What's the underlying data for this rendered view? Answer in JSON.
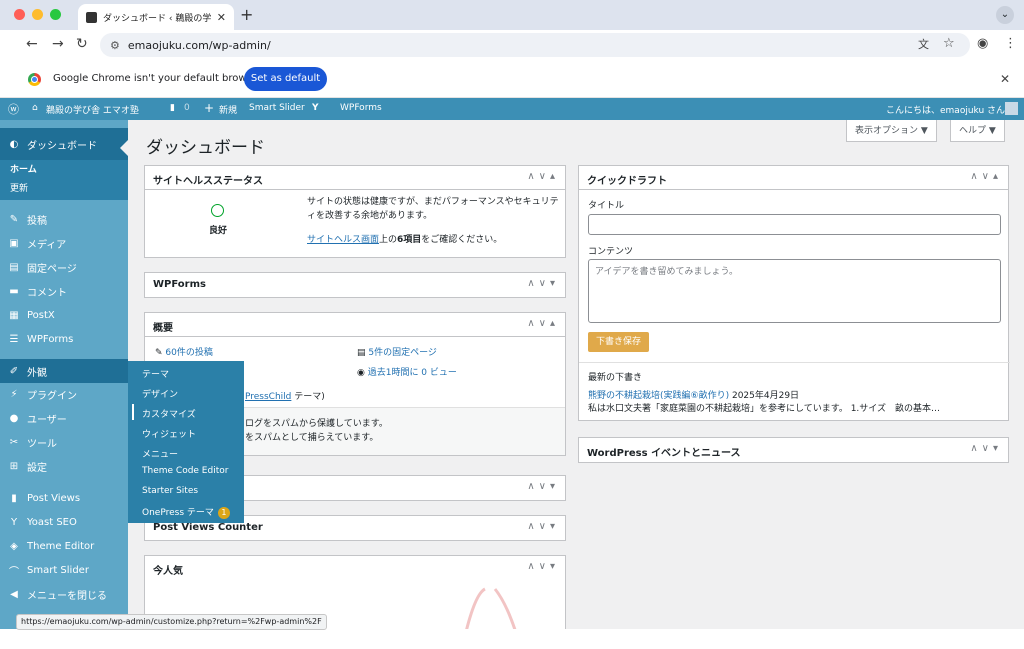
{
  "browser": {
    "tab_title": "ダッシュボード ‹ 鵜殿の学び舎 エ",
    "new_tab": "+",
    "url": "emaojuku.com/wp-admin/",
    "infobar_text": "Google Chrome isn't your default browser",
    "set_default": "Set as default",
    "status_url": "https://emaojuku.com/wp-admin/customize.php?return=%2Fwp-admin%2F"
  },
  "adminbar": {
    "site_name": "鵜殿の学び舎 エマオ塾",
    "comments": "0",
    "new": "新規",
    "smart_slider": "Smart Slider",
    "wpforms": "WPForms",
    "greeting": "こんにちは、emaojuku さん"
  },
  "sidebar": {
    "dashboard": "ダッシュボード",
    "home": "ホーム",
    "updates": "更新",
    "items": [
      {
        "label": "投稿",
        "icon": "pin-icon"
      },
      {
        "label": "メディア",
        "icon": "media-icon"
      },
      {
        "label": "固定ページ",
        "icon": "page-icon"
      },
      {
        "label": "コメント",
        "icon": "comment-icon"
      },
      {
        "label": "PostX",
        "icon": "postx-icon"
      },
      {
        "label": "WPForms",
        "icon": "wpforms-icon"
      },
      {
        "label": "外観",
        "icon": "appearance-icon"
      },
      {
        "label": "プラグイン",
        "icon": "plugin-icon"
      },
      {
        "label": "ユーザー",
        "icon": "user-icon"
      },
      {
        "label": "ツール",
        "icon": "tool-icon"
      },
      {
        "label": "設定",
        "icon": "settings-icon"
      },
      {
        "label": "Post Views",
        "icon": "chart-icon"
      },
      {
        "label": "Yoast SEO",
        "icon": "yoast-icon"
      },
      {
        "label": "Theme Editor",
        "icon": "editor-icon"
      },
      {
        "label": "Smart Slider",
        "icon": "slider-icon"
      },
      {
        "label": "メニューを閉じる",
        "icon": "collapse-icon"
      }
    ]
  },
  "flyout": {
    "items": [
      "テーマ",
      "デザイン",
      "カスタマイズ",
      "ウィジェット",
      "メニュー",
      "Theme Code Editor",
      "Starter Sites",
      "OnePress テーマ"
    ],
    "badge": "1"
  },
  "main": {
    "title": "ダッシュボード",
    "screen_options": "表示オプション ▼",
    "help": "ヘルプ ▼"
  },
  "health": {
    "title": "サイトヘルスステータス",
    "status": "良好",
    "text": "サイトの状態は健康ですが、まだパフォーマンスやセキュリティを改善する余地があります。",
    "link_text": "サイトヘルス画面",
    "link_suffix_1": "上の",
    "link_bold": "6項目",
    "link_suffix_2": "をご確認ください。"
  },
  "wpforms_box": {
    "title": "WPForms"
  },
  "overview": {
    "title": "概要",
    "posts": "60件の投稿",
    "pages": "5件の固定ページ",
    "views": "過去1時間に 0 ビュー",
    "theme_link": "PressChild",
    "theme_suffix": " テーマ)",
    "akismet_1": "ログをスパムから保護しています。",
    "akismet_2": "をスパムとして捕らえています。"
  },
  "postviews": {
    "title": "Post Views Counter"
  },
  "popular": {
    "title": "今人気"
  },
  "quickdraft": {
    "title": "クイックドラフト",
    "title_label": "タイトル",
    "content_label": "コンテンツ",
    "content_placeholder": "アイデアを書き留めてみましょう。",
    "save": "下書き保存",
    "recent_label": "最新の下書き",
    "recent_link": "熊野の不耕起栽培(実践編⑥畝作り)",
    "recent_date": "2025年4月29日",
    "recent_excerpt": "私は水口文夫著「家庭菜園の不耕起栽培」を参考にしています。 1.サイズ　畝の基本…"
  },
  "events": {
    "title": "WordPress イベントとニュース"
  },
  "colors": {
    "sidebar": "#5ea7c7",
    "adminbar": "#3c8fb5",
    "active": "#1f6f96",
    "link": "#2271b1"
  }
}
